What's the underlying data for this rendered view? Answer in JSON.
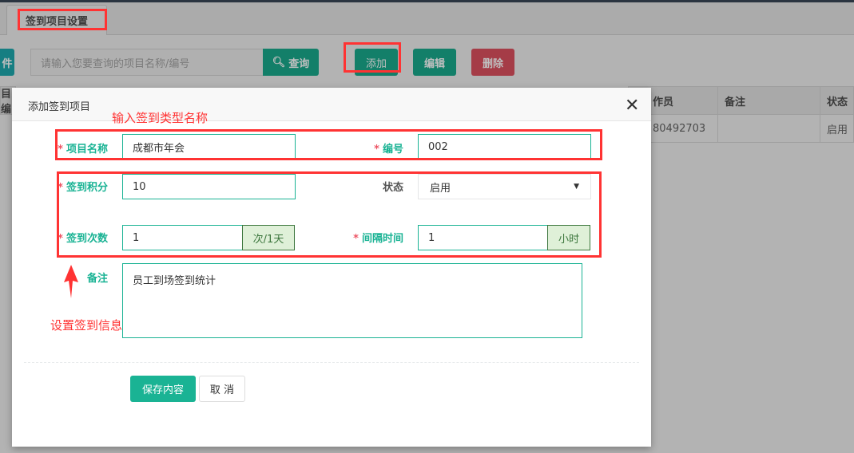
{
  "tabs": [
    {
      "label": "签到项目设置"
    }
  ],
  "toolbar": {
    "left_button_partial": "件",
    "search_placeholder": "请输入您要查询的项目名称/编号",
    "search_label": "查询",
    "add_label": "添加",
    "edit_label": "编辑",
    "delete_label": "删除"
  },
  "table": {
    "headers": [
      "目编",
      "作员",
      "备注",
      "状态"
    ],
    "rows": [
      [
        "",
        "80492703",
        "",
        "启用"
      ]
    ]
  },
  "modal": {
    "title": "添加签到项目",
    "fields": {
      "name": {
        "label": "项目名称",
        "value": "成都市年会",
        "required": true
      },
      "code": {
        "label": "编号",
        "value": "002",
        "required": true
      },
      "points": {
        "label": "签到积分",
        "value": "10",
        "required": true
      },
      "status": {
        "label": "状态",
        "value": "启用"
      },
      "count": {
        "label": "签到次数",
        "value": "1",
        "addon": "次/1天",
        "required": true
      },
      "interval": {
        "label": "间隔时间",
        "value": "1",
        "addon": "小时",
        "required": true
      },
      "remark": {
        "label": "备注",
        "value": "员工到场签到统计"
      }
    },
    "save_label": "保存内容",
    "cancel_label": "取 消"
  },
  "annotations": {
    "name_hint": "输入签到类型名称",
    "info_hint": "设置签到信息"
  },
  "colors": {
    "primary": "#1ab394",
    "danger": "#ed5565",
    "annotation": "#ff3333"
  }
}
